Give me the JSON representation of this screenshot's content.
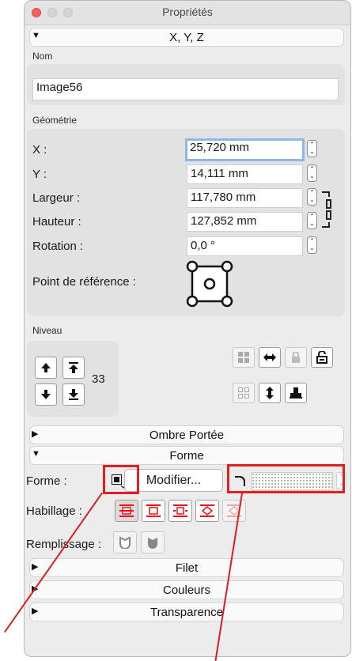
{
  "window": {
    "title": "Propriétés"
  },
  "sections": {
    "xyz": "X, Y, Z",
    "ombre": "Ombre Portée",
    "forme": "Forme",
    "filet": "Filet",
    "couleurs": "Couleurs",
    "transparence": "Transparence"
  },
  "nom": {
    "label": "Nom",
    "value": "Image56"
  },
  "geometrie": {
    "label": "Géométrie",
    "x_label": "X :",
    "x_value": "25,720 mm",
    "y_label": "Y :",
    "y_value": "14,111 mm",
    "largeur_label": "Largeur :",
    "largeur_value": "117,780 mm",
    "hauteur_label": "Hauteur :",
    "hauteur_value": "127,852 mm",
    "rotation_label": "Rotation :",
    "rotation_value": "0,0 °",
    "ref_label": "Point de référence :"
  },
  "niveau": {
    "label": "Niveau",
    "value": "33"
  },
  "forme": {
    "forme_label": "Forme :",
    "modifier_label": "Modifier...",
    "habillage_label": "Habillage :",
    "remplissage_label": "Remplissage :"
  },
  "colors": {
    "highlight": "#e02020",
    "focus": "#8db8ea",
    "window_bg": "#ececec"
  }
}
